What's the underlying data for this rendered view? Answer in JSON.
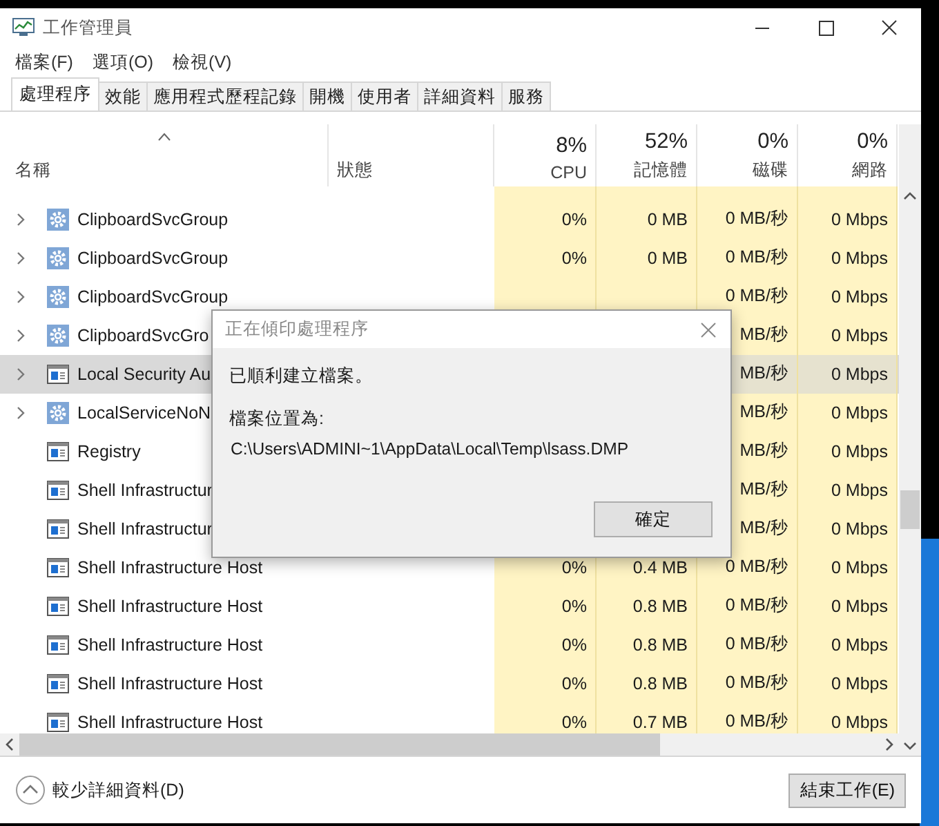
{
  "window": {
    "title": "工作管理員"
  },
  "menu": [
    "檔案(F)",
    "選項(O)",
    "檢視(V)"
  ],
  "tabs": [
    {
      "label": "處理程序",
      "selected": true
    },
    {
      "label": "效能",
      "selected": false
    },
    {
      "label": "應用程式歷程記錄",
      "selected": false
    },
    {
      "label": "開機",
      "selected": false
    },
    {
      "label": "使用者",
      "selected": false
    },
    {
      "label": "詳細資料",
      "selected": false
    },
    {
      "label": "服務",
      "selected": false
    }
  ],
  "columns": [
    {
      "kind": "name",
      "label": "名稱",
      "sorted": true
    },
    {
      "kind": "status",
      "label": "狀態",
      "sorted": false
    },
    {
      "kind": "metric",
      "usage": "8%",
      "label": "CPU",
      "sorted": false
    },
    {
      "kind": "metric",
      "usage": "52%",
      "label": "記憶體",
      "sorted": false
    },
    {
      "kind": "metric",
      "usage": "0%",
      "label": "磁碟",
      "sorted": false
    },
    {
      "kind": "metric",
      "usage": "0%",
      "label": "網路",
      "sorted": false
    }
  ],
  "rows": [
    {
      "name": "ClipboardSvcGroup",
      "kind": "service_group",
      "expandable": true,
      "selected": false,
      "cpu": "0%",
      "memory": "0 MB",
      "disk": "0 MB/秒",
      "network": "0 Mbps"
    },
    {
      "name": "ClipboardSvcGroup",
      "kind": "service_group",
      "expandable": true,
      "selected": false,
      "cpu": "0%",
      "memory": "0 MB",
      "disk": "0 MB/秒",
      "network": "0 Mbps"
    },
    {
      "name": "ClipboardSvcGroup",
      "kind": "service_group",
      "expandable": true,
      "selected": false,
      "disk": "0 MB/秒",
      "network": "0 Mbps"
    },
    {
      "name": "ClipboardSvcGro",
      "kind": "service_group",
      "expandable": true,
      "selected": false,
      "disk": "MB/秒",
      "network": "0 Mbps"
    },
    {
      "name": "Local Security Au",
      "kind": "process",
      "expandable": true,
      "selected": true,
      "disk": "MB/秒",
      "network": "0 Mbps"
    },
    {
      "name": "LocalServiceNoN",
      "kind": "service_group",
      "expandable": true,
      "selected": false,
      "disk": "MB/秒",
      "network": "0 Mbps"
    },
    {
      "name": "Registry",
      "kind": "process",
      "expandable": false,
      "selected": false,
      "disk": "MB/秒",
      "network": "0 Mbps"
    },
    {
      "name": "Shell Infrastructur",
      "kind": "process",
      "expandable": false,
      "selected": false,
      "disk": "MB/秒",
      "network": "0 Mbps"
    },
    {
      "name": "Shell Infrastructur",
      "kind": "process",
      "expandable": false,
      "selected": false,
      "disk": "MB/秒",
      "network": "0 Mbps"
    },
    {
      "name": "Shell Infrastructure Host",
      "kind": "process",
      "expandable": false,
      "selected": false,
      "cpu": "0%",
      "memory": "0.4 MB",
      "disk": "0 MB/秒",
      "network": "0 Mbps"
    },
    {
      "name": "Shell Infrastructure Host",
      "kind": "process",
      "expandable": false,
      "selected": false,
      "cpu": "0%",
      "memory": "0.8 MB",
      "disk": "0 MB/秒",
      "network": "0 Mbps"
    },
    {
      "name": "Shell Infrastructure Host",
      "kind": "process",
      "expandable": false,
      "selected": false,
      "cpu": "0%",
      "memory": "0.8 MB",
      "disk": "0 MB/秒",
      "network": "0 Mbps"
    },
    {
      "name": "Shell Infrastructure Host",
      "kind": "process",
      "expandable": false,
      "selected": false,
      "cpu": "0%",
      "memory": "0.8 MB",
      "disk": "0 MB/秒",
      "network": "0 Mbps"
    },
    {
      "name": "Shell Infrastructure Host",
      "kind": "process",
      "expandable": false,
      "selected": false,
      "cpu": "0%",
      "memory": "0.7 MB",
      "disk": "0 MB/秒",
      "network": "0 Mbps"
    }
  ],
  "footer": {
    "fewer_details": "較少詳細資料(D)",
    "end_task": "結束工作(E)"
  },
  "dialog": {
    "title": "正在傾印處理程序",
    "message": "已順利建立檔案。",
    "location_label": "檔案位置為:",
    "path": "C:\\Users\\ADMINI~1\\AppData\\Local\\Temp\\lsass.DMP",
    "ok": "確定"
  }
}
